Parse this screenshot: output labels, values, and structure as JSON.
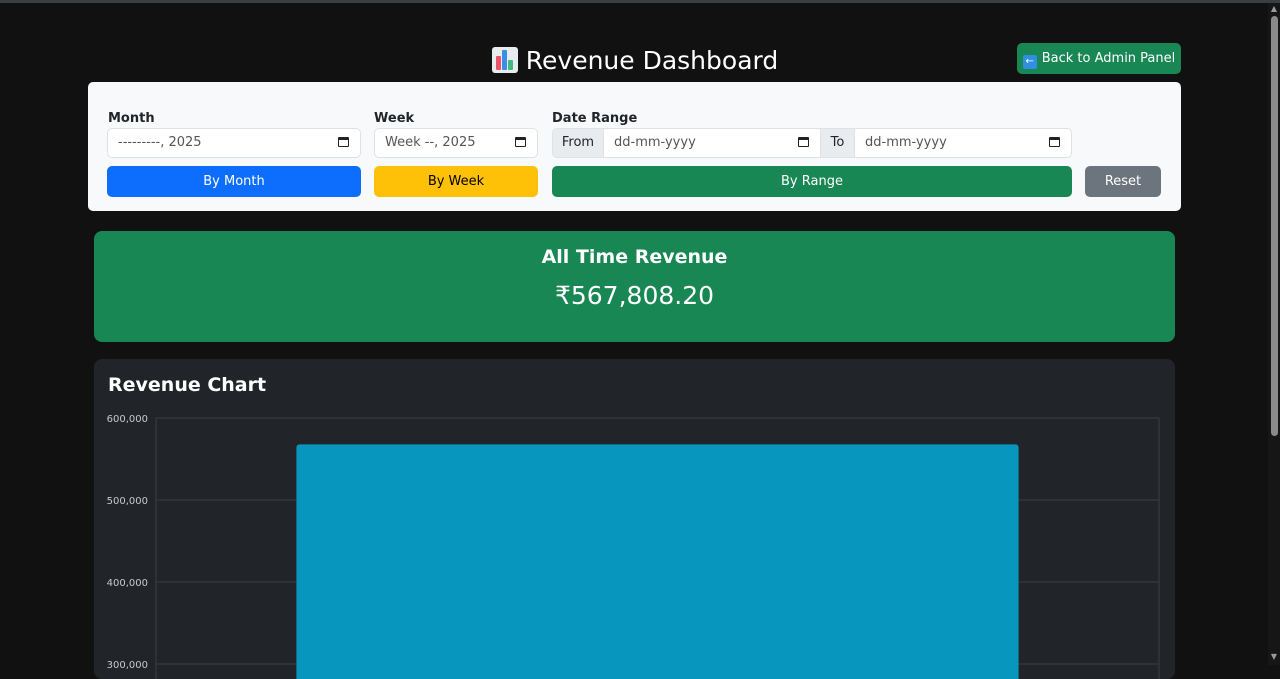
{
  "header": {
    "title": "Revenue Dashboard",
    "back_button": "Back to Admin Panel"
  },
  "filters": {
    "month": {
      "label": "Month",
      "value": "---------, 2025"
    },
    "week": {
      "label": "Week",
      "value": "Week --, 2025"
    },
    "date_range": {
      "label": "Date Range",
      "from_label": "From",
      "to_label": "To",
      "from_value": "dd-mm-yyyy",
      "to_value": "dd-mm-yyyy"
    },
    "buttons": {
      "by_month": "By Month",
      "by_week": "By Week",
      "by_range": "By Range",
      "reset": "Reset"
    }
  },
  "summary": {
    "title": "All Time Revenue",
    "value": "₹567,808.20"
  },
  "chart": {
    "title": "Revenue Chart"
  },
  "colors": {
    "primary": "#0d6efd",
    "warning": "#ffc107",
    "success": "#198754",
    "secondary": "#6c757d",
    "bar": "#0797be"
  },
  "chart_data": {
    "type": "bar",
    "categories": [
      ""
    ],
    "values": [
      567808.2
    ],
    "title": "",
    "xlabel": "",
    "ylabel": "",
    "ylim": [
      300000,
      600000
    ],
    "yticks": [
      300000,
      400000,
      500000,
      600000
    ],
    "ytick_labels": [
      "300,000",
      "400,000",
      "500,000",
      "600,000"
    ],
    "grid": true
  }
}
